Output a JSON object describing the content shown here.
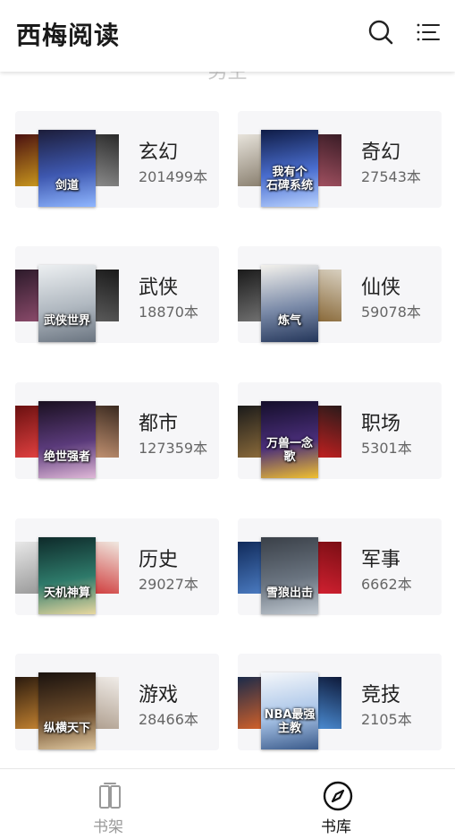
{
  "app": {
    "title": "西梅阅读"
  },
  "section": {
    "heading": "男生"
  },
  "categories": [
    {
      "name": "玄幻",
      "count": "201499本",
      "cover_title": "剑道",
      "colors": [
        "#1c1d3a",
        "#3e58b0",
        "#8fb6ff"
      ],
      "side_left": [
        "#4a1010",
        "#c8961e"
      ],
      "side_right": [
        "#2a2a2a",
        "#8a8a8a"
      ]
    },
    {
      "name": "奇幻",
      "count": "27543本",
      "cover_title": "我有个\n石碑系统",
      "colors": [
        "#0f1c46",
        "#4a6ed0",
        "#b8d2ff"
      ],
      "side_left": [
        "#e8e4dc",
        "#8a8070"
      ],
      "side_right": [
        "#3a1c26",
        "#a05060"
      ]
    },
    {
      "name": "武侠",
      "count": "18870本",
      "cover_title": "武侠世界",
      "colors": [
        "#eceff1",
        "#b0b8c0",
        "#6a7480"
      ],
      "side_left": [
        "#2c1a2a",
        "#8a4a6a"
      ],
      "side_right": [
        "#1a1a1a",
        "#5a5a5a"
      ]
    },
    {
      "name": "仙侠",
      "count": "59078本",
      "cover_title": "炼气",
      "colors": [
        "#f3f1ec",
        "#7a8aa8",
        "#24365a"
      ],
      "side_left": [
        "#1a1a1a",
        "#707070"
      ],
      "side_right": [
        "#d8d0c0",
        "#8a6a3a"
      ]
    },
    {
      "name": "都市",
      "count": "127359本",
      "cover_title": "绝世强者",
      "colors": [
        "#1a1020",
        "#5a3a7a",
        "#e0b8d8"
      ],
      "side_left": [
        "#6a1010",
        "#e04040"
      ],
      "side_right": [
        "#3a2a20",
        "#c09070"
      ]
    },
    {
      "name": "职场",
      "count": "5301本",
      "cover_title": "万兽一念歌",
      "colors": [
        "#140e2a",
        "#4a2e7a",
        "#f0c030"
      ],
      "side_left": [
        "#1a1a1a",
        "#8a6a3a"
      ],
      "side_right": [
        "#2a1a1a",
        "#c02020"
      ]
    },
    {
      "name": "历史",
      "count": "29027本",
      "cover_title": "天机神算",
      "colors": [
        "#0e2a2a",
        "#2e7a6a",
        "#e8d8a0"
      ],
      "side_left": [
        "#e8e8e8",
        "#9a9a9a"
      ],
      "side_right": [
        "#f0e8e0",
        "#d04040"
      ]
    },
    {
      "name": "军事",
      "count": "6662本",
      "cover_title": "雪狼出击",
      "colors": [
        "#3a4048",
        "#6a7480",
        "#c0c8d0"
      ],
      "side_left": [
        "#102a5a",
        "#4a7ac0"
      ],
      "side_right": [
        "#7a0e14",
        "#d02030"
      ]
    },
    {
      "name": "游戏",
      "count": "28466本",
      "cover_title": "纵横天下",
      "colors": [
        "#1a120e",
        "#6a4a2a",
        "#e0c8a0"
      ],
      "side_left": [
        "#2a1a0e",
        "#c08030"
      ],
      "side_right": [
        "#f0ece8",
        "#b0a090"
      ]
    },
    {
      "name": "竞技",
      "count": "2105本",
      "cover_title": "NBA最强主教",
      "colors": [
        "#f5f7fa",
        "#a8c4e8",
        "#3a5a8a"
      ],
      "side_left": [
        "#1a2a4a",
        "#d0602a"
      ],
      "side_right": [
        "#0e1a3a",
        "#4a8ad0"
      ]
    }
  ],
  "tabs": [
    {
      "label": "书架",
      "icon": "bookshelf-icon",
      "active": false
    },
    {
      "label": "书库",
      "icon": "compass-icon",
      "active": true
    }
  ],
  "theme": {
    "active_color": "#111111",
    "inactive_color": "#999999",
    "card_bg": "#f6f6f8"
  }
}
